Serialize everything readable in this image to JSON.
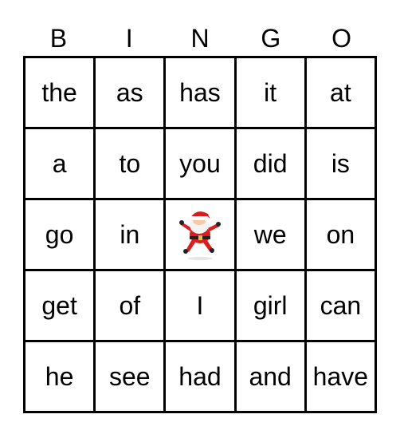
{
  "header": [
    "B",
    "I",
    "N",
    "G",
    "O"
  ],
  "rows": [
    [
      "the",
      "as",
      "has",
      "it",
      "at"
    ],
    [
      "a",
      "to",
      "you",
      "did",
      "is"
    ],
    [
      "go",
      "in",
      "",
      "we",
      "on"
    ],
    [
      "get",
      "of",
      "I",
      "girl",
      "can"
    ],
    [
      "he",
      "see",
      "had",
      "and",
      "have"
    ]
  ],
  "free_space": {
    "icon": "santa-icon"
  }
}
